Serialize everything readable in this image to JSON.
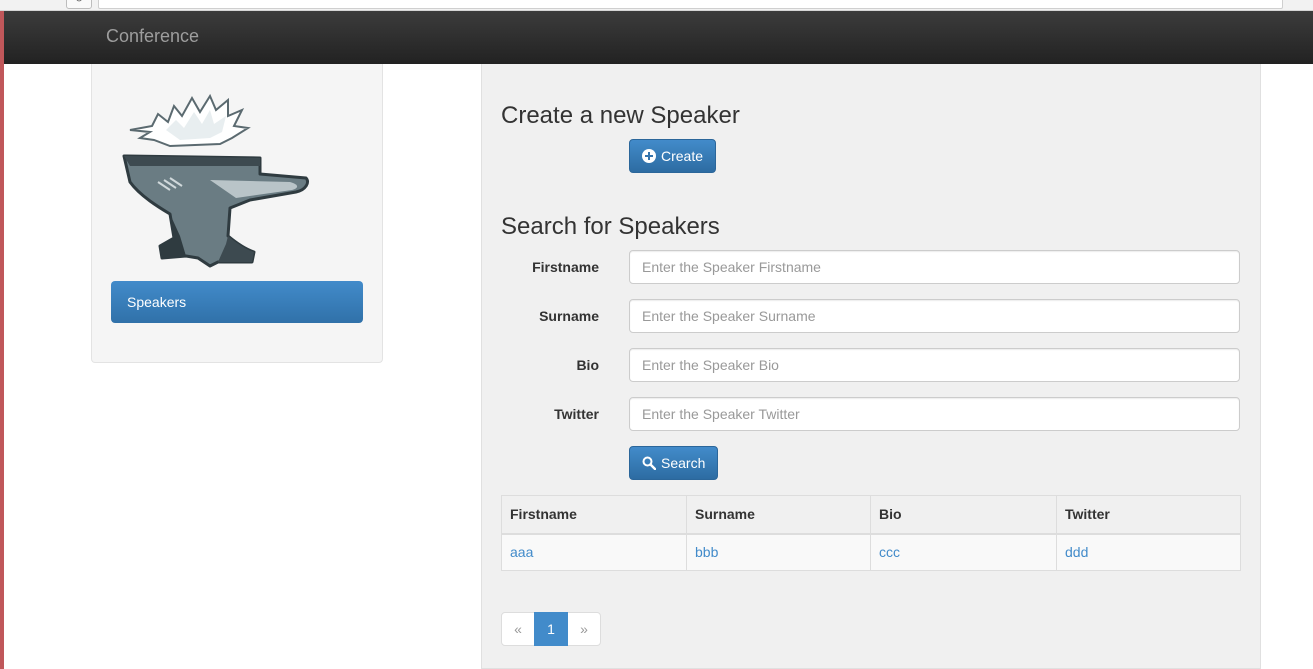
{
  "navbar": {
    "brand": "Conference"
  },
  "sidebar": {
    "logo_icon": "anvil-logo-icon",
    "items": [
      {
        "label": "Speakers",
        "active": true
      }
    ]
  },
  "main": {
    "create_section": {
      "heading": "Create a new Speaker",
      "button_label": "Create",
      "button_icon": "plus-circle-icon"
    },
    "search_section": {
      "heading": "Search for Speakers",
      "fields": [
        {
          "label": "Firstname",
          "placeholder": "Enter the Speaker Firstname",
          "value": ""
        },
        {
          "label": "Surname",
          "placeholder": "Enter the Speaker Surname",
          "value": ""
        },
        {
          "label": "Bio",
          "placeholder": "Enter the Speaker Bio",
          "value": ""
        },
        {
          "label": "Twitter",
          "placeholder": "Enter the Speaker Twitter",
          "value": ""
        }
      ],
      "button_label": "Search",
      "button_icon": "search-icon"
    },
    "results": {
      "columns": [
        "Firstname",
        "Surname",
        "Bio",
        "Twitter"
      ],
      "rows": [
        [
          "aaa",
          "bbb",
          "ccc",
          "ddd"
        ]
      ]
    },
    "pagination": {
      "prev": "«",
      "pages": [
        "1"
      ],
      "current": "1",
      "next": "»"
    }
  },
  "colors": {
    "navbar_bg": "#222222",
    "primary": "#428bca",
    "link": "#428bca",
    "panel_bg": "#f0f0f0"
  }
}
